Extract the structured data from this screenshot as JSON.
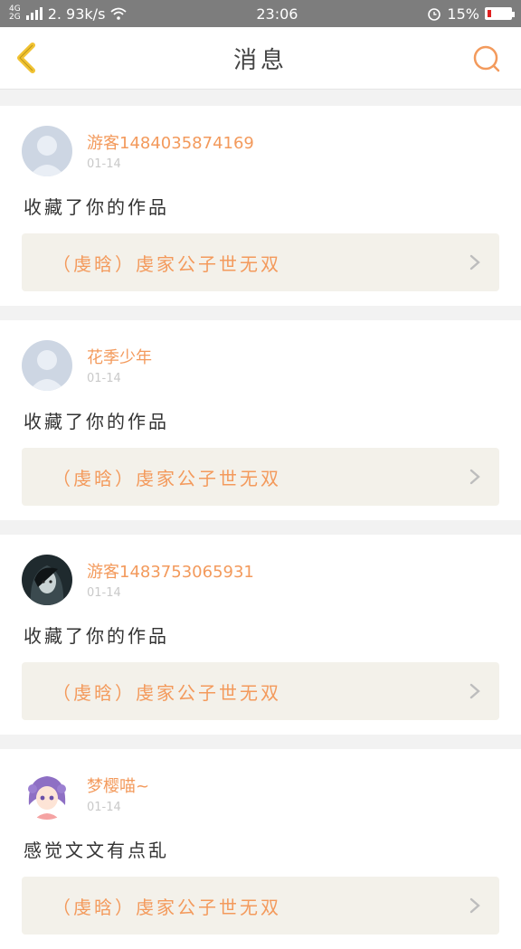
{
  "status": {
    "network": [
      "4G",
      "2G"
    ],
    "speed": "2. 93k/s",
    "time": "23:06",
    "battery_text": "15%",
    "battery_level": 0.15
  },
  "header": {
    "title": "消息"
  },
  "colors": {
    "accent": "#f39a5c",
    "back": "#f1c232",
    "card_link_bg": "#f3f1ea"
  },
  "messages": [
    {
      "name": "游客1484035874169",
      "date": "01-14",
      "text": "收藏了你的作品",
      "work": "（虔晗）虔家公子世无双",
      "avatar": "placeholder"
    },
    {
      "name": "花季少年",
      "date": "01-14",
      "text": "收藏了你的作品",
      "work": "（虔晗）虔家公子世无双",
      "avatar": "placeholder"
    },
    {
      "name": "游客1483753065931",
      "date": "01-14",
      "text": "收藏了你的作品",
      "work": "（虔晗）虔家公子世无双",
      "avatar": "dark-portrait"
    },
    {
      "name": "梦樱喵~",
      "date": "01-14",
      "text": "感觉文文有点乱",
      "work": "（虔晗）虔家公子世无双",
      "avatar": "anime-girl"
    }
  ]
}
